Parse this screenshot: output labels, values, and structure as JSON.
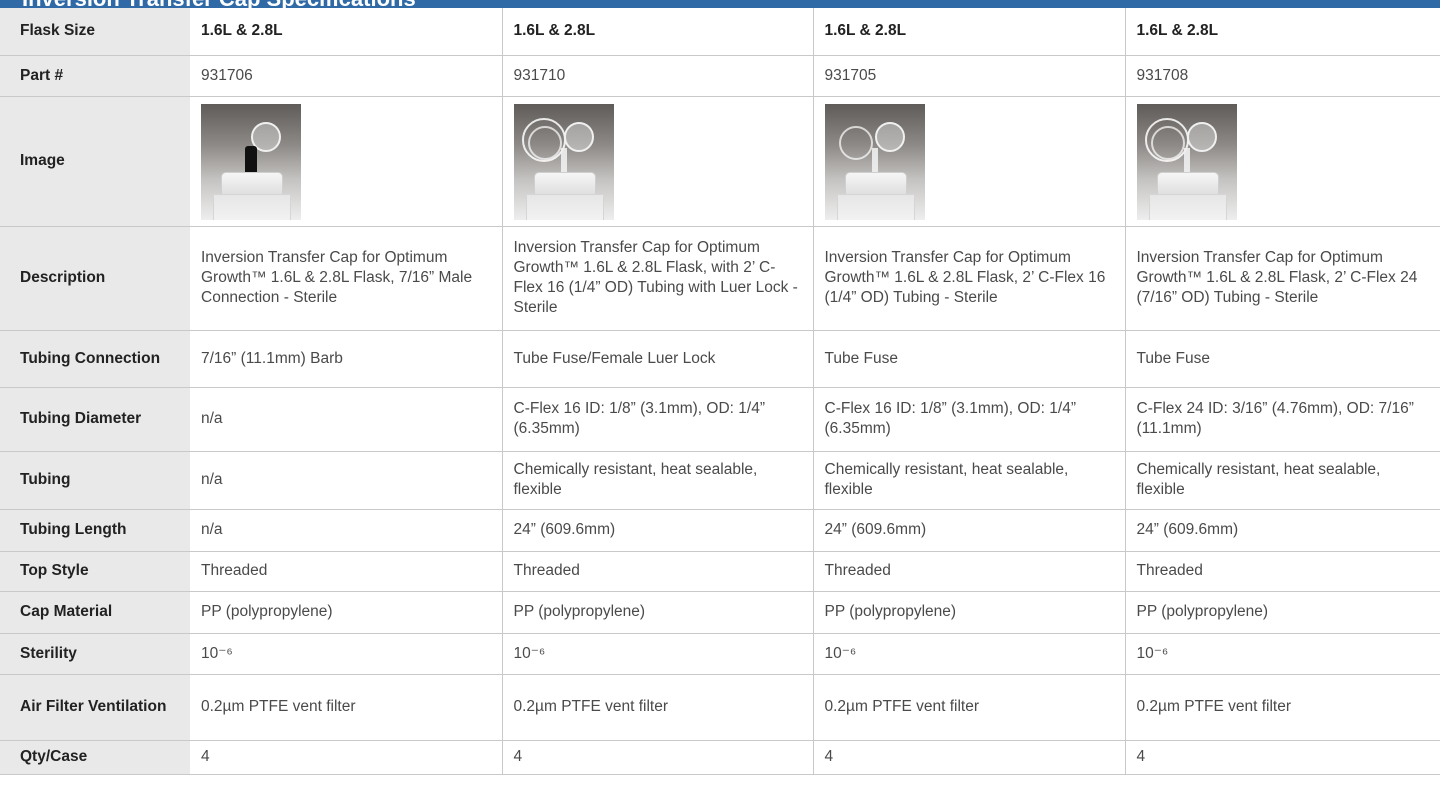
{
  "header": {
    "title_fragment": "Inversion Transfer Cap Specifications"
  },
  "rows": [
    {
      "label": "Flask Size",
      "values": [
        "1.6L & 2.8L",
        "1.6L & 2.8L",
        "1.6L & 2.8L",
        "1.6L & 2.8L"
      ]
    },
    {
      "label": "Part #",
      "values": [
        "931706",
        "931710",
        "931705",
        "931708"
      ]
    },
    {
      "label": "Image",
      "values": [
        "barb-cap-product-image",
        "luer-lock-tubing-cap-product-image",
        "c-flex-16-tubing-cap-product-image",
        "c-flex-24-tubing-cap-product-image"
      ]
    },
    {
      "label": "Description",
      "values": [
        "Inversion Transfer Cap for Optimum Growth™ 1.6L & 2.8L Flask, 7/16” Male Connection - Sterile",
        "Inversion Transfer Cap for Optimum Growth™ 1.6L & 2.8L Flask, with 2’ C-Flex 16 (1/4” OD) Tubing with Luer Lock - Sterile",
        "Inversion Transfer Cap for Optimum Growth™ 1.6L & 2.8L Flask, 2’ C-Flex 16 (1/4” OD) Tubing - Sterile",
        "Inversion Transfer Cap for Optimum Growth™ 1.6L & 2.8L Flask, 2’ C-Flex 24 (7/16” OD) Tubing - Sterile"
      ]
    },
    {
      "label": "Tubing Connection",
      "values": [
        "7/16” (11.1mm) Barb",
        "Tube Fuse/Female Luer Lock",
        "Tube Fuse",
        "Tube Fuse"
      ]
    },
    {
      "label": "Tubing Diameter",
      "values": [
        "n/a",
        "C-Flex 16 ID: 1/8” (3.1mm), OD: 1/4” (6.35mm)",
        "C-Flex 16 ID: 1/8” (3.1mm), OD: 1/4” (6.35mm)",
        "C-Flex 24 ID: 3/16” (4.76mm), OD: 7/16” (11.1mm)"
      ]
    },
    {
      "label": "Tubing",
      "values": [
        "n/a",
        "Chemically resistant, heat sealable, flexible",
        "Chemically resistant, heat sealable, flexible",
        "Chemically resistant, heat sealable, flexible"
      ]
    },
    {
      "label": "Tubing Length",
      "values": [
        "n/a",
        "24” (609.6mm)",
        "24” (609.6mm)",
        "24” (609.6mm)"
      ]
    },
    {
      "label": "Top Style",
      "values": [
        "Threaded",
        "Threaded",
        "Threaded",
        "Threaded"
      ]
    },
    {
      "label": "Cap Material",
      "values": [
        "PP (polypropylene)",
        "PP (polypropylene)",
        "PP (polypropylene)",
        "PP (polypropylene)"
      ]
    },
    {
      "label": "Sterility",
      "values": [
        "10⁻⁶",
        "10⁻⁶",
        "10⁻⁶",
        "10⁻⁶"
      ]
    },
    {
      "label": "Air Filter Ventilation",
      "values": [
        "0.2µm PTFE vent filter",
        "0.2µm PTFE vent filter",
        "0.2µm PTFE vent filter",
        "0.2µm PTFE vent filter"
      ]
    },
    {
      "label": "Qty/Case",
      "values": [
        "4",
        "4",
        "4",
        "4"
      ]
    }
  ]
}
